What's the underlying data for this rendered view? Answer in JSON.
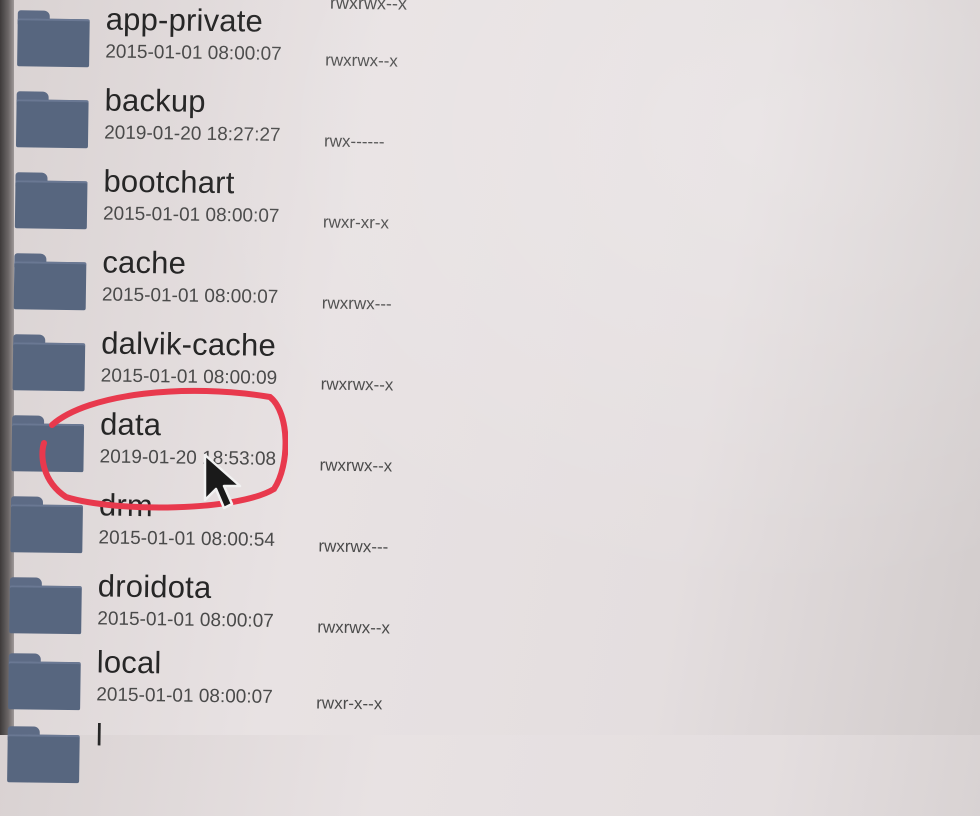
{
  "top_cutoff_text": "rwxrwx--x",
  "files": [
    {
      "name": "app-private",
      "date": "2015-01-01 08:00:07",
      "perm": "rwxrwx--x",
      "icon": "folder-icon"
    },
    {
      "name": "backup",
      "date": "2019-01-20 18:27:27",
      "perm": "rwx------",
      "icon": "folder-icon"
    },
    {
      "name": "bootchart",
      "date": "2015-01-01 08:00:07",
      "perm": "rwxr-xr-x",
      "icon": "folder-icon"
    },
    {
      "name": "cache",
      "date": "2015-01-01 08:00:07",
      "perm": "rwxrwx---",
      "icon": "folder-icon"
    },
    {
      "name": "dalvik-cache",
      "date": "2015-01-01 08:00:09",
      "perm": "rwxrwx--x",
      "icon": "folder-icon"
    },
    {
      "name": "data",
      "date": "2019-01-20 18:53:08",
      "perm": "rwxrwx--x",
      "icon": "folder-icon"
    },
    {
      "name": "drm",
      "date": "2015-01-01 08:00:54",
      "perm": "rwxrwx---",
      "icon": "folder-icon"
    },
    {
      "name": "droidota",
      "date": "2015-01-01 08:00:07",
      "perm": "rwxrwx--x",
      "icon": "folder-icon"
    },
    {
      "name": "local",
      "date": "2015-01-01 08:00:07",
      "perm": "rwxr-x--x",
      "icon": "folder-icon"
    },
    {
      "name": "l",
      "date": "",
      "perm": "",
      "icon": "folder-icon"
    }
  ],
  "colors": {
    "folder": "#57667f",
    "highlight": "#e8394d",
    "text": "#262626"
  }
}
